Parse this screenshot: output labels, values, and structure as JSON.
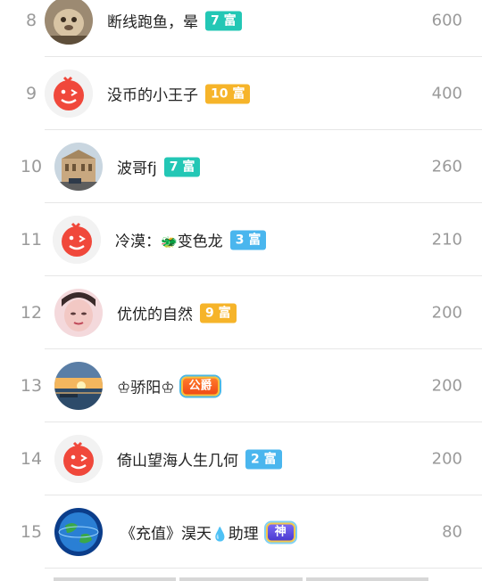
{
  "leaderboard": {
    "rows": [
      {
        "rank": "8",
        "name": "断线跑鱼，晕",
        "badge": "7 富",
        "badge_color": "#23c7b5",
        "score": "600",
        "avatar": "photo-cat-icon"
      },
      {
        "rank": "9",
        "name": "没币的小王子",
        "badge": "10 富",
        "badge_color": "#f6b42a",
        "score": "400",
        "avatar": "weibo-default-avatar-icon"
      },
      {
        "rank": "10",
        "name": "波哥fj",
        "badge": "7 富",
        "badge_color": "#23c7b5",
        "score": "260",
        "avatar": "photo-building-icon"
      },
      {
        "rank": "11",
        "name": "冷漠：",
        "name_emoji": "🐲",
        "name_suffix": "变色龙",
        "badge": "3 富",
        "badge_color": "#4ab6ee",
        "score": "210",
        "avatar": "weibo-default-avatar-icon"
      },
      {
        "rank": "12",
        "name": "优优的自然",
        "badge": "9 富",
        "badge_color": "#f6b42a",
        "score": "200",
        "avatar": "photo-face-icon"
      },
      {
        "rank": "13",
        "name": "♔骄阳♔",
        "badge": "公爵",
        "badge_color": "#f04a16",
        "score": "200",
        "avatar": "photo-sunset-icon"
      },
      {
        "rank": "14",
        "name": "倚山望海人生几何",
        "badge": "2 富",
        "badge_color": "#4ab6ee",
        "score": "200",
        "avatar": "weibo-default-avatar-icon"
      },
      {
        "rank": "15",
        "name": "《充值》淏天",
        "name_emoji": "💧",
        "name_suffix": "助理",
        "badge": "神",
        "badge_color": "#5a48dd",
        "score": "80",
        "avatar": "photo-globe-icon"
      }
    ]
  }
}
